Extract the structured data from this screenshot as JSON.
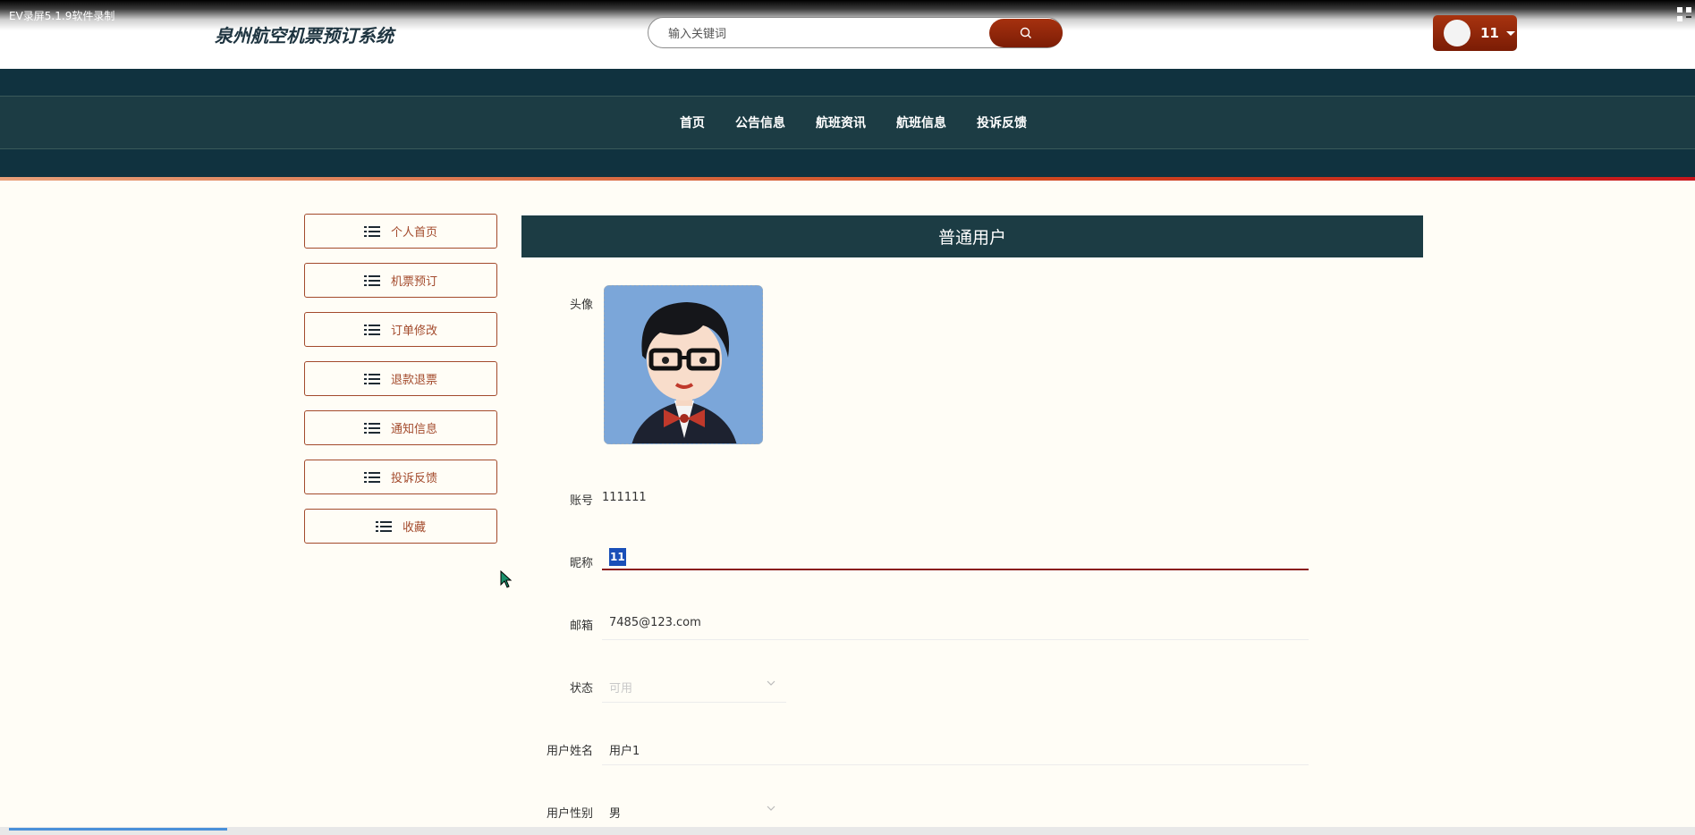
{
  "recorder": {
    "label": "EV录屏5.1.9软件录制"
  },
  "header": {
    "site_title": "泉州航空机票预订系统",
    "search_placeholder": "输入关键词",
    "search_icon": "search-icon",
    "user_name": "11"
  },
  "nav": {
    "items": [
      {
        "label": "首页"
      },
      {
        "label": "公告信息"
      },
      {
        "label": "航班资讯"
      },
      {
        "label": "航班信息"
      },
      {
        "label": "投诉反馈"
      }
    ]
  },
  "sidebar": {
    "items": [
      {
        "label": "个人首页",
        "icon": "list-icon"
      },
      {
        "label": "机票预订",
        "icon": "list-icon"
      },
      {
        "label": "订单修改",
        "icon": "list-icon"
      },
      {
        "label": "退款退票",
        "icon": "list-icon"
      },
      {
        "label": "通知信息",
        "icon": "list-icon"
      },
      {
        "label": "投诉反馈",
        "icon": "list-icon"
      },
      {
        "label": "收藏",
        "icon": "list-icon"
      }
    ]
  },
  "profile": {
    "title": "普通用户",
    "avatar_label": "头像",
    "account_label": "账号",
    "account_value": "111111",
    "nickname_label": "昵称",
    "nickname_value": "11",
    "email_label": "邮箱",
    "email_value": "7485@123.com",
    "status_label": "状态",
    "status_value": "可用",
    "realname_label": "用户姓名",
    "realname_value": "用户1",
    "gender_label": "用户性别",
    "gender_value": "男"
  },
  "colors": {
    "navbar": "#10323f",
    "accent_red": "#a34a2c",
    "title_bar": "#1c3c44",
    "selection": "#1a4fb8"
  }
}
